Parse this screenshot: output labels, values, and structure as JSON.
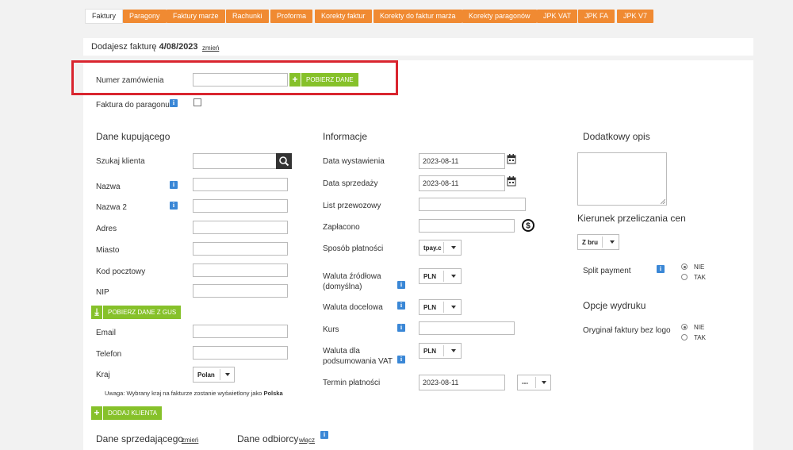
{
  "tabs": [
    "Faktury",
    "Paragony",
    "Faktury marże",
    "Rachunki",
    "Proforma",
    "Korekty faktur",
    "Korekty do faktur marża",
    "Korekty paragonów",
    "JPK VAT",
    "JPK FA",
    "JPK V7"
  ],
  "header": {
    "prefix": "Dodajesz fakturę",
    "date": "4/08/2023",
    "change_link": "zmień"
  },
  "order": {
    "label": "Numer zamówienia",
    "value": "",
    "button": "POBIERZ DANE"
  },
  "receipt": {
    "label": "Faktura do paragonu"
  },
  "buyer": {
    "title": "Dane kupującego",
    "search_label": "Szukaj klienta",
    "fields": {
      "name": "Nazwa",
      "name2": "Nazwa 2",
      "address": "Adres",
      "city": "Miasto",
      "postal": "Kod pocztowy",
      "nip": "NIP",
      "email": "Email",
      "phone": "Telefon",
      "country": "Kraj"
    },
    "gus_button": "POBIERZ DANE Z GUS",
    "country_value": "Polan",
    "note_prefix": "Uwaga: Wybrany kraj na fakturze zostanie wyświetlony jako",
    "note_country": "Polska",
    "add_client_button": "DODAJ KLIENTA"
  },
  "info": {
    "title": "Informacje",
    "issue_date_label": "Data wystawienia",
    "issue_date": "2023-08-11",
    "sale_date_label": "Data sprzedaży",
    "sale_date": "2023-08-11",
    "waybill_label": "List przewozowy",
    "paid_label": "Zapłacono",
    "payment_method_label": "Sposób płatności",
    "payment_method": "tpay.c",
    "src_currency_label": "Waluta źródłowa (domyślna)",
    "src_currency": "PLN",
    "target_currency_label": "Waluta docelowa",
    "target_currency": "PLN",
    "rate_label": "Kurs",
    "vat_currency_label": "Waluta dla podsumowania VAT",
    "vat_currency": "PLN",
    "due_label": "Termin płatności",
    "due_date": "2023-08-11",
    "due_select": "---"
  },
  "extra": {
    "desc_title": "Dodatkowy opis",
    "price_direction_title": "Kierunek przeliczania cen",
    "price_direction_value": "Z bru",
    "split_label": "Split payment",
    "no": "NIE",
    "yes": "TAK",
    "print_title": "Opcje wydruku",
    "original_label": "Oryginał faktury bez logo"
  },
  "bottom": {
    "seller": "Dane sprzedającego",
    "seller_link": "zmień",
    "receiver": "Dane odbiorcy",
    "receiver_link": "włącz"
  },
  "colors": {
    "accent": "#f08a32",
    "green": "#86c12a",
    "info": "#3a87d6",
    "highlight": "#d9252f"
  }
}
